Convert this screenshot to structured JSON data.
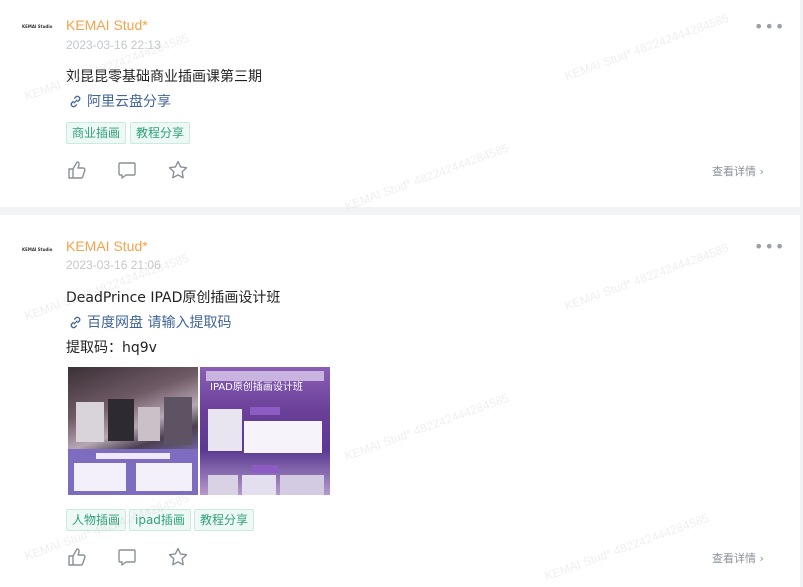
{
  "watermark": "KEMAI Stud* 482242444284585",
  "posts": [
    {
      "avatar_text": "KEMAI Studio",
      "author": "KEMAI Stud*",
      "date": "2023-03-16 22:13",
      "more": "•••",
      "title": "刘昆昆零基础商业插画课第三期",
      "link": "阿里云盘分享",
      "tags": [
        "商业插画",
        "教程分享"
      ],
      "detail": "查看详情"
    },
    {
      "avatar_text": "KEMAI Studio",
      "author": "KEMAI Stud*",
      "date": "2023-03-16 21:06",
      "more": "•••",
      "title": "DeadPrince IPAD原创插画设计班",
      "link": "百度网盘 请输入提取码",
      "extract": "提取码：hq9v",
      "image2_title": "IPAD原创插画设计班",
      "tags": [
        "人物插画",
        "ipad插画",
        "教程分享"
      ],
      "detail": "查看详情"
    }
  ]
}
